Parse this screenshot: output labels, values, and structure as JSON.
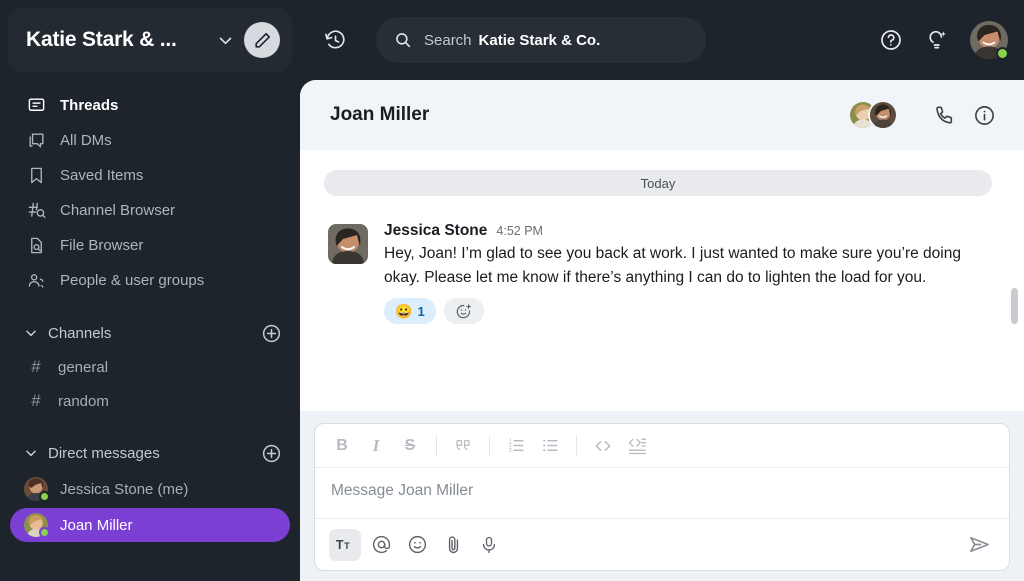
{
  "workspace": {
    "title": "Katie Stark & ...",
    "chevron_icon": "chevron-down-icon",
    "compose_icon": "pencil-icon"
  },
  "sidebar": {
    "nav_items": [
      {
        "label": "Threads",
        "icon": "threads-icon",
        "active": true
      },
      {
        "label": "All DMs",
        "icon": "all-dms-icon",
        "active": false
      },
      {
        "label": "Saved Items",
        "icon": "bookmark-icon",
        "active": false
      },
      {
        "label": "Channel Browser",
        "icon": "channel-browser-icon",
        "active": false
      },
      {
        "label": "File Browser",
        "icon": "file-browser-icon",
        "active": false
      },
      {
        "label": "People & user groups",
        "icon": "people-icon",
        "active": false
      }
    ],
    "channels_section": {
      "label": "Channels",
      "add_icon": "plus-circle-icon",
      "items": [
        {
          "label": "general",
          "prefix": "#"
        },
        {
          "label": "random",
          "prefix": "#"
        }
      ]
    },
    "dms_section": {
      "label": "Direct messages",
      "add_icon": "plus-circle-icon",
      "items": [
        {
          "label": "Jessica Stone (me)",
          "selected": false,
          "presence": "online"
        },
        {
          "label": "Joan Miller",
          "selected": true,
          "presence": "online"
        }
      ]
    }
  },
  "topbar": {
    "history_icon": "history-clock-icon",
    "search": {
      "icon": "search-icon",
      "prefix": "Search",
      "scope": "Katie Stark & Co."
    },
    "help_icon": "help-circle-icon",
    "assist_icon": "lightbulb-sparkle-icon",
    "user_avatar": "avatar",
    "user_presence": "online"
  },
  "conversation": {
    "title": "Joan Miller",
    "facepile_count": 2,
    "call_icon": "phone-icon",
    "info_icon": "info-circle-icon",
    "date_divider": "Today",
    "messages": [
      {
        "author": "Jessica Stone",
        "time": "4:52 PM",
        "text": "Hey, Joan! I’m glad to see you back at work. I just wanted to make sure you’re doing okay. Please let me know if there’s anything I can do to lighten the load for you.",
        "reactions": [
          {
            "emoji": "😀",
            "count": "1"
          }
        ],
        "add_reaction_icon": "add-reaction-icon"
      }
    ]
  },
  "composer": {
    "placeholder": "Message Joan Miller",
    "format_buttons": [
      {
        "name": "bold-button",
        "glyph": "B"
      },
      {
        "name": "italic-button",
        "glyph": "I"
      },
      {
        "name": "strikethrough-button",
        "glyph": "S"
      },
      {
        "name": "blockquote-button",
        "glyph": "””"
      },
      {
        "name": "ordered-list-button",
        "glyph": "list-ordered-icon"
      },
      {
        "name": "bulleted-list-button",
        "glyph": "list-bullet-icon"
      },
      {
        "name": "code-button",
        "glyph": "<>"
      },
      {
        "name": "code-block-button",
        "glyph": "code-block-icon"
      }
    ],
    "action_buttons": [
      {
        "name": "formatting-toggle",
        "icon": "text-format-icon",
        "active": true
      },
      {
        "name": "mention-button",
        "icon": "at-icon",
        "active": false
      },
      {
        "name": "emoji-button",
        "icon": "emoji-icon",
        "active": false
      },
      {
        "name": "attach-button",
        "icon": "paperclip-icon",
        "active": false
      },
      {
        "name": "audio-button",
        "icon": "microphone-icon",
        "active": false
      }
    ],
    "send_icon": "send-icon"
  },
  "colors": {
    "sidebar_bg": "#1d242b",
    "accent_purple": "#7b3fd4",
    "presence_green": "#8cd14c",
    "reaction_blue": "#dbeefd",
    "composer_bg": "#eef2f7"
  }
}
